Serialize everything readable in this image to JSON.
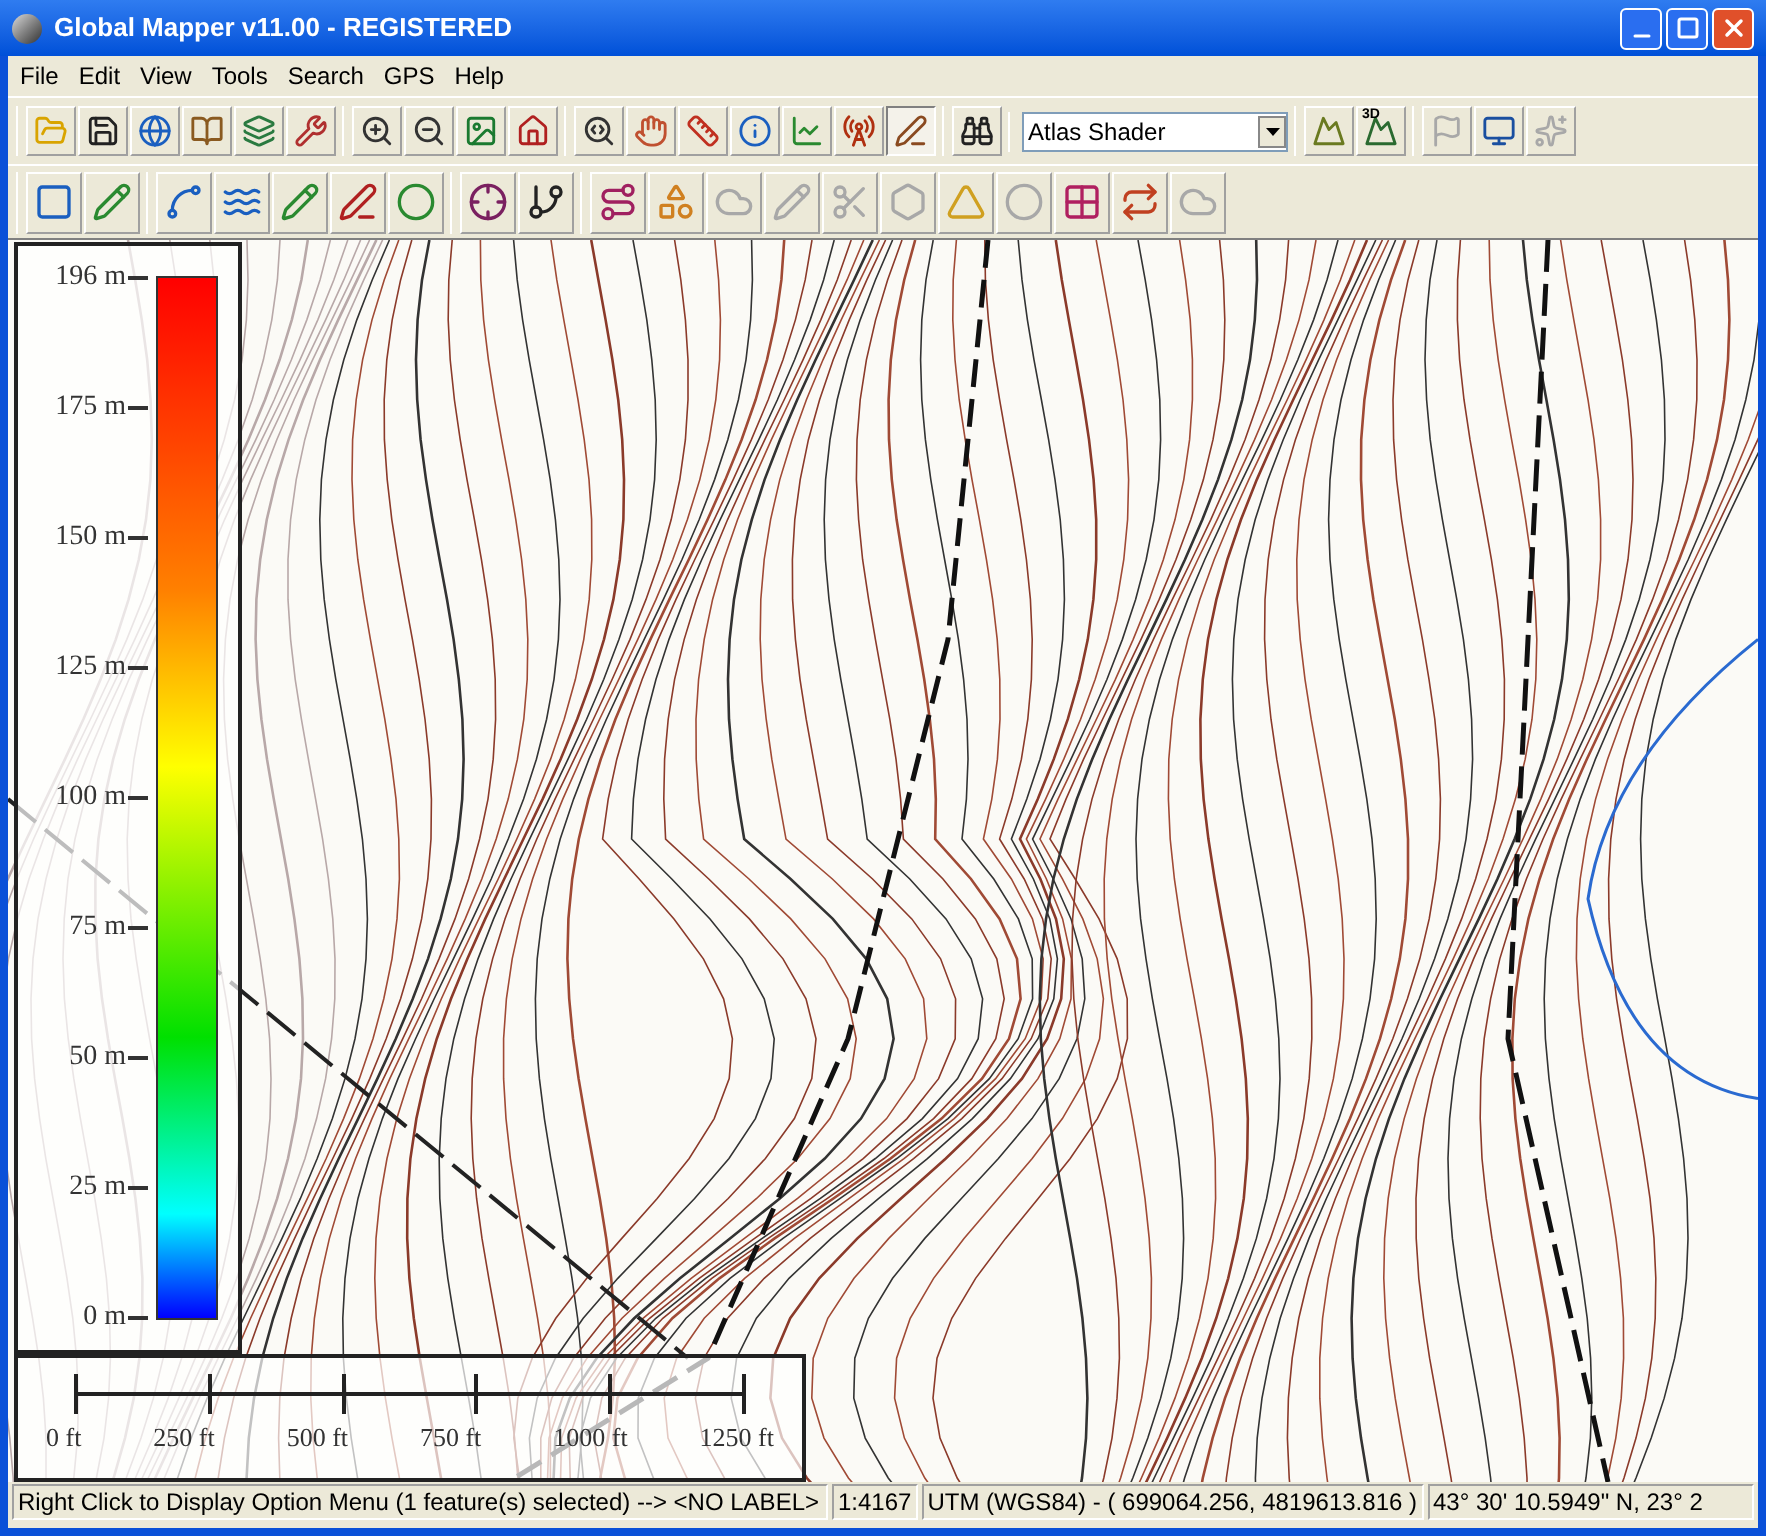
{
  "window": {
    "title": "Global Mapper v11.00 - REGISTERED"
  },
  "menu": [
    "File",
    "Edit",
    "View",
    "Tools",
    "Search",
    "GPS",
    "Help"
  ],
  "toolbar_1": [
    [
      {
        "pressed": false,
        "disabled": false
      },
      {
        "pressed": false,
        "disabled": false
      },
      {
        "pressed": false,
        "disabled": false
      },
      {
        "pressed": false,
        "disabled": false
      },
      {
        "pressed": false,
        "disabled": false
      },
      {
        "pressed": false,
        "disabled": false
      }
    ],
    [
      {
        "pressed": false,
        "disabled": false
      },
      {
        "pressed": false,
        "disabled": false
      },
      {
        "pressed": false,
        "disabled": false
      },
      {
        "pressed": false,
        "disabled": false
      }
    ],
    [
      {
        "pressed": false,
        "disabled": false
      },
      {
        "pressed": false,
        "disabled": false
      },
      {
        "pressed": false,
        "disabled": false
      },
      {
        "pressed": false,
        "disabled": false
      },
      {
        "pressed": false,
        "disabled": false
      },
      {
        "pressed": false,
        "disabled": false
      },
      {
        "pressed": true,
        "disabled": false
      }
    ],
    [
      {
        "pressed": false,
        "disabled": false
      }
    ]
  ],
  "shader_dropdown": {
    "value": "Atlas Shader"
  },
  "toolbar_1_end": [
    [
      {
        "pressed": false,
        "disabled": false
      },
      {
        "pressed": false,
        "disabled": false,
        "label": "3D"
      }
    ],
    [
      {
        "pressed": false,
        "disabled": true
      },
      {
        "pressed": false,
        "disabled": false
      },
      {
        "pressed": false,
        "disabled": true
      }
    ]
  ],
  "toolbar_2": [
    [
      {
        "disabled": false
      },
      {
        "disabled": false
      }
    ],
    [
      {
        "disabled": false
      },
      {
        "disabled": false
      },
      {
        "disabled": false
      },
      {
        "disabled": false
      },
      {
        "disabled": false
      }
    ],
    [
      {
        "disabled": false
      },
      {
        "disabled": false
      }
    ],
    [
      {
        "disabled": false
      },
      {
        "disabled": false
      },
      {
        "disabled": true
      },
      {
        "disabled": true
      },
      {
        "disabled": true
      },
      {
        "disabled": true
      },
      {
        "disabled": false
      },
      {
        "disabled": true
      },
      {
        "disabled": false
      },
      {
        "disabled": false
      },
      {
        "disabled": true
      }
    ]
  ],
  "elevation_legend": {
    "labels": [
      "196 m",
      "175 m",
      "150 m",
      "125 m",
      "100 m",
      "75 m",
      "50 m",
      "25 m",
      "0 m"
    ]
  },
  "scale_bar": {
    "labels": [
      "0 ft",
      "250 ft",
      "500 ft",
      "750 ft",
      "1000 ft",
      "1250 ft"
    ]
  },
  "status_bar": [
    "Right Click to Display Option Menu (1 feature(s) selected) --> <NO LABEL>",
    "1:4167",
    "UTM (WGS84) - ( 699064.256, 4819613.816 )",
    "43° 30' 10.5949\" N, 23° 2"
  ]
}
